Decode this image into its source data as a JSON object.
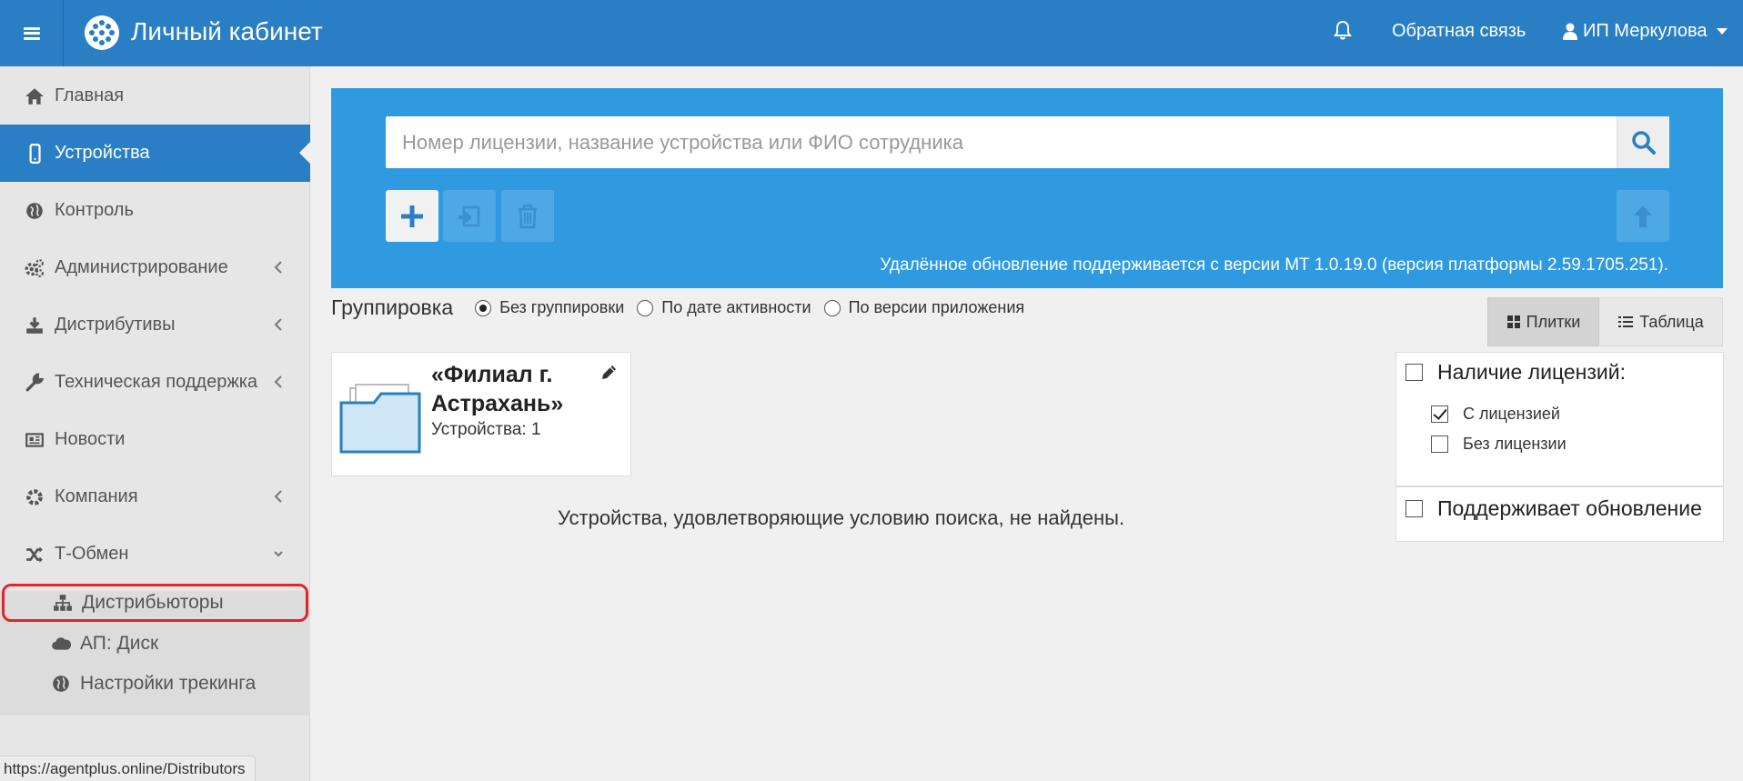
{
  "header": {
    "app_title": "Личный кабинет",
    "feedback_label": "Обратная связь",
    "user_name": "ИП Меркулова",
    "brand_color": "#2a7fc4"
  },
  "sidebar": {
    "items": [
      {
        "label": "Главная",
        "icon": "home-icon"
      },
      {
        "label": "Устройства",
        "icon": "mobile-icon",
        "active": true
      },
      {
        "label": "Контроль",
        "icon": "globe-icon"
      },
      {
        "label": "Администрирование",
        "icon": "gears-icon",
        "expandable": true
      },
      {
        "label": "Дистрибутивы",
        "icon": "download-icon",
        "expandable": true
      },
      {
        "label": "Техническая поддержка",
        "icon": "wrench-icon",
        "expandable": true
      },
      {
        "label": "Новости",
        "icon": "newspaper-icon"
      },
      {
        "label": "Компания",
        "icon": "gear-icon",
        "expandable": true
      },
      {
        "label": "Т-Обмен",
        "icon": "shuffle-icon",
        "expanded": true
      }
    ],
    "subitems": [
      {
        "label": "Дистрибьюторы",
        "icon": "sitemap-icon",
        "highlighted": true
      },
      {
        "label": "АП: Диск",
        "icon": "cloud-icon"
      },
      {
        "label": "Настройки трекинга",
        "icon": "globe-icon"
      }
    ]
  },
  "status_bar": {
    "url": "https://agentplus.online/Distributors"
  },
  "search": {
    "placeholder": "Номер лицензии, название устройства или ФИО сотрудника",
    "value": ""
  },
  "version_note": "Удалённое обновление поддерживается с версии МТ 1.0.19.0 (версия платформы 2.59.1705.251).",
  "grouping": {
    "label": "Группировка",
    "options": [
      {
        "label": "Без группировки",
        "selected": true
      },
      {
        "label": "По дате активности",
        "selected": false
      },
      {
        "label": "По версии приложения",
        "selected": false
      }
    ]
  },
  "view": {
    "tiles_label": "Плитки",
    "table_label": "Таблица",
    "selected": "tiles"
  },
  "group_tile": {
    "title": "«Филиал г. Астрахань»",
    "count_text": "Устройства: 1"
  },
  "empty_message": "Устройства, удовлетворяющие условию поиска, не найдены.",
  "filters": {
    "license": {
      "label": "Наличие лицензий:",
      "checked": false,
      "options": [
        {
          "label": "С лицензией",
          "checked": true
        },
        {
          "label": "Без лицензии",
          "checked": false
        }
      ]
    },
    "update": {
      "label": "Поддерживает обновление",
      "checked": false
    }
  }
}
